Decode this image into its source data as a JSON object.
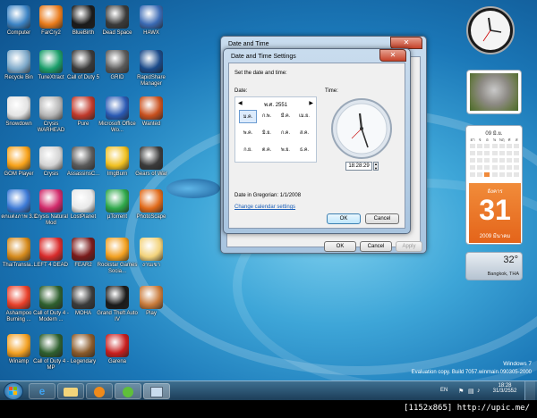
{
  "desktop": {
    "icons": [
      {
        "label": "Computer",
        "icon": "computer-icon",
        "color": "#3b83c4"
      },
      {
        "label": "Recycle Bin",
        "icon": "recycle-bin-icon",
        "color": "#7ca8c9"
      },
      {
        "label": "Snowdown",
        "icon": "game-icon",
        "color": "#e3e3e3"
      },
      {
        "label": "GOM Player",
        "icon": "gom-player-icon",
        "color": "#f7a21a"
      },
      {
        "label": "ตกแต่งภาพ 3.3",
        "icon": "paint-icon",
        "color": "#3d7ad6"
      },
      {
        "label": "ThaiTransla...",
        "icon": "dictionary-icon",
        "color": "#d58a1c"
      },
      {
        "label": "Ashampoo Burning ...",
        "icon": "disc-icon",
        "color": "#e8402a"
      },
      {
        "label": "Winamp",
        "icon": "winamp-icon",
        "color": "#f2a022"
      },
      {
        "label": "FarCry2",
        "icon": "farcry-icon",
        "color": "#e87a1a"
      },
      {
        "label": "TuneXtract",
        "icon": "tune-icon",
        "color": "#1a9e6a"
      },
      {
        "label": "Crysis WARHEAD",
        "icon": "crysis-icon",
        "color": "#b5b5b5"
      },
      {
        "label": "Crysis",
        "icon": "crysis-icon",
        "color": "#d3d3d3"
      },
      {
        "label": "Crysis Natural Mod",
        "icon": "crysis-icon",
        "color": "#d12a6a"
      },
      {
        "label": "LEFT 4 DEAD",
        "icon": "l4d-icon",
        "color": "#d82b2b"
      },
      {
        "label": "Call of Duty 4 - Modern ...",
        "icon": "cod4-icon",
        "color": "#2e5f2e"
      },
      {
        "label": "Call of Duty 4 - MP",
        "icon": "cod4-icon",
        "color": "#2e5f2e"
      },
      {
        "label": "BlueBirth",
        "icon": "game-icon",
        "color": "#1a1a1a"
      },
      {
        "label": "Call of Duty 5",
        "icon": "game-icon",
        "color": "#3a3a3a"
      },
      {
        "label": "Pure",
        "icon": "game-icon",
        "color": "#c0392b"
      },
      {
        "label": "AssassinsC...",
        "icon": "game-icon",
        "color": "#5a5a5a"
      },
      {
        "label": "LostPlanet",
        "icon": "game-icon",
        "color": "#e8e8e8"
      },
      {
        "label": "FEAR2",
        "icon": "game-icon",
        "color": "#7a1a1a"
      },
      {
        "label": "MOHA",
        "icon": "game-icon",
        "color": "#3a3a3a"
      },
      {
        "label": "Legendary",
        "icon": "game-icon",
        "color": "#8a5a2a"
      },
      {
        "label": "Dead Space",
        "icon": "game-icon",
        "color": "#3a3a3a"
      },
      {
        "label": "GRID",
        "icon": "game-icon",
        "color": "#5a5a5a"
      },
      {
        "label": "Microsoft Office Wo...",
        "icon": "word-icon",
        "color": "#2a5ab4"
      },
      {
        "label": "ImgBurn",
        "icon": "disc-icon",
        "color": "#f0c020"
      },
      {
        "label": "µTorrent",
        "icon": "utorrent-icon",
        "color": "#2ea84a"
      },
      {
        "label": "Rockstar Games Socia...",
        "icon": "rockstar-icon",
        "color": "#f2a020"
      },
      {
        "label": "Grand Theft Auto IV",
        "icon": "gta-icon",
        "color": "#1a1a1a"
      },
      {
        "label": "Garena",
        "icon": "garena-icon",
        "color": "#c81e1e"
      },
      {
        "label": "HAWX",
        "icon": "game-icon",
        "color": "#3a6ab4"
      },
      {
        "label": "RapidShare Manager",
        "icon": "rapidshare-icon",
        "color": "#1a4a8a"
      },
      {
        "label": "Wanted",
        "icon": "game-icon",
        "color": "#c8501e"
      },
      {
        "label": "Gears of War",
        "icon": "game-icon",
        "color": "#3a3a3a"
      },
      {
        "label": "PhotoScape",
        "icon": "photoscape-icon",
        "color": "#e06a1a"
      },
      {
        "label": "งานเขา",
        "icon": "folder-icon",
        "color": "#f2d27a"
      },
      {
        "label": "Play",
        "icon": "play-icon",
        "color": "#c87a3a"
      }
    ]
  },
  "datetime_window": {
    "title": "Date and Time",
    "ok": "OK",
    "cancel": "Cancel",
    "apply": "Apply"
  },
  "settings_dialog": {
    "title": "Date and Time Settings",
    "instruction": "Set the date and time:",
    "date_label": "Date:",
    "time_label": "Time:",
    "month_header": "พ.ศ. 2551",
    "months": [
      "ม.ค.",
      "ก.พ.",
      "มี.ค.",
      "เม.ย.",
      "พ.ค.",
      "มิ.ย.",
      "ก.ค.",
      "ส.ค.",
      "ก.ย.",
      "ต.ค.",
      "พ.ย.",
      "ธ.ค."
    ],
    "selected_month": "ม.ค.",
    "time_value": "18:28:29",
    "gregorian": "Date in Gregorian: 1/1/2008",
    "change_calendar_link": "Change calendar settings",
    "ok": "OK",
    "cancel": "Cancel"
  },
  "gadgets": {
    "calendar_header": "09 มิ.ย.",
    "calendar_day_names": [
      "อา",
      "จ",
      "อ",
      "พ",
      "พฤ",
      "ศ",
      "ส"
    ],
    "calendar_highlight": "31",
    "big_day_name": "อังคาร",
    "big_day_number": "31",
    "big_month_year": "2009 มีนาคม",
    "weather_temp": "32°",
    "weather_location": "Bangkok, THA"
  },
  "watermark": {
    "os": "Windows 7",
    "build": "Evaluation copy. Build 7057.winmain.090305-2000"
  },
  "taskbar": {
    "lang": "EN",
    "time": "18:28",
    "date": "31/3/2552"
  },
  "footer": {
    "credit": "[1152x865] http://upic.me/"
  }
}
